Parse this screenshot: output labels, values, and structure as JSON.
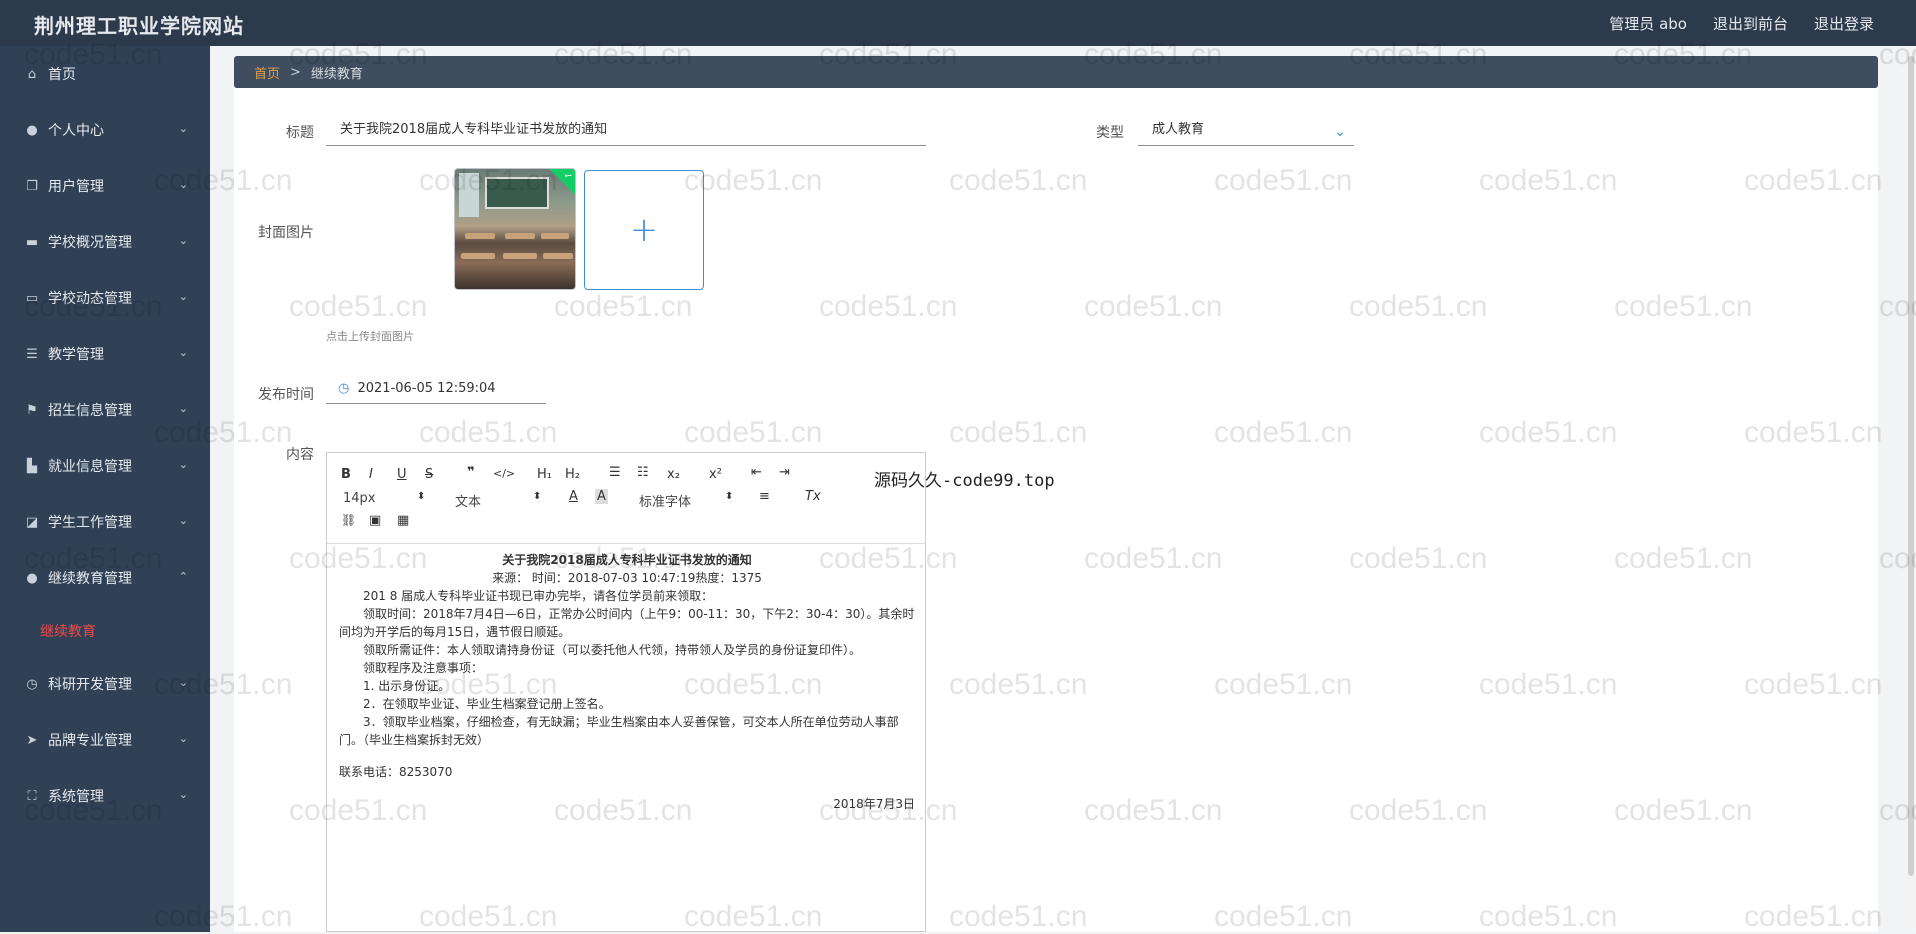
{
  "header": {
    "site_title": "荆州理工职业学院网站",
    "user_label": "管理员 abo",
    "front_label": "退出到前台",
    "logout_label": "退出登录"
  },
  "sidebar": {
    "items": [
      {
        "label": "首页",
        "icon": "home-icon",
        "has_chevron": false
      },
      {
        "label": "个人中心",
        "icon": "user-icon",
        "has_chevron": true
      },
      {
        "label": "用户管理",
        "icon": "copy-icon",
        "has_chevron": true
      },
      {
        "label": "学校概况管理",
        "icon": "briefcase-icon",
        "has_chevron": true
      },
      {
        "label": "学校动态管理",
        "icon": "chat-icon",
        "has_chevron": true
      },
      {
        "label": "教学管理",
        "icon": "sliders-icon",
        "has_chevron": true
      },
      {
        "label": "招生信息管理",
        "icon": "flag-icon",
        "has_chevron": true
      },
      {
        "label": "就业信息管理",
        "icon": "car-icon",
        "has_chevron": true
      },
      {
        "label": "学生工作管理",
        "icon": "chart-icon",
        "has_chevron": true
      },
      {
        "label": "继续教育管理",
        "icon": "person-icon",
        "has_chevron": true,
        "expanded": true
      }
    ],
    "sub_item": "继续教育",
    "items_after": [
      {
        "label": "科研开发管理",
        "icon": "clock-icon"
      },
      {
        "label": "品牌专业管理",
        "icon": "send-icon"
      },
      {
        "label": "系统管理",
        "icon": "fullscreen-icon"
      }
    ]
  },
  "breadcrumb": {
    "home": "首页",
    "separator": ">",
    "current": "继续教育"
  },
  "form": {
    "title_label": "标题",
    "title_value": "关于我院2018届成人专科毕业证书发放的通知",
    "type_label": "类型",
    "type_value": "成人教育",
    "cover_label": "封面图片",
    "upload_hint": "点击上传封面图片",
    "date_label": "发布时间",
    "date_value": "2021-06-05 12:59:04",
    "content_label": "内容"
  },
  "editor": {
    "toolbar": {
      "bold": "B",
      "italic": "I",
      "underline": "U",
      "strike": "S",
      "quote": "❞",
      "code": "</>",
      "h1": "H₁",
      "h2": "H₂",
      "ol": "☰",
      "ul": "☷",
      "sub": "x₂",
      "sup": "x²",
      "outdent": "⇤",
      "indent": "⇥",
      "size": "14px",
      "header": "文本",
      "font": "标准字体",
      "color": "A",
      "bg": "A",
      "align": "≡",
      "clean": "Tx",
      "link": "🔗",
      "image": "▣",
      "video": "▦"
    },
    "content": {
      "title": "关于我院2018届成人专科毕业证书发放的通知",
      "source": "来源：  时间：2018-07-03 10:47:19热度：1375",
      "lines": [
        "　　201  8  届成人专科毕业证书现已审办完毕，请各位学员前来领取：",
        "　　领取时间：2018年7月4日—6日，正常办公时间内（上午9：00-11：30，下午2：30-4：30）。其余时间均为开学后的每月15日，遇节假日顺延。",
        "　　领取所需证件：本人领取请持身份证（可以委托他人代领，持带领人及学员的身份证复印件）。",
        "　　领取程序及注意事项：",
        "　　1. 出示身份证。",
        "　　2．在领取毕业证、毕业生档案登记册上签名。",
        "　　3．领取毕业档案，仔细检查，有无缺漏；毕业生档案由本人妥善保管，可交本人所在单位劳动人事部门。（毕业生档案拆封无效）"
      ],
      "phone": "联系电话：8253070",
      "date": "2018年7月3日"
    }
  },
  "watermark": {
    "overlay_text": "源码久久-code99.top",
    "repeat_text": "code51.cn"
  },
  "colors": {
    "topbar": "#2d3a4b",
    "sidebar": "#304156",
    "active_sub": "#f04848",
    "accent": "#3f8fd7"
  }
}
